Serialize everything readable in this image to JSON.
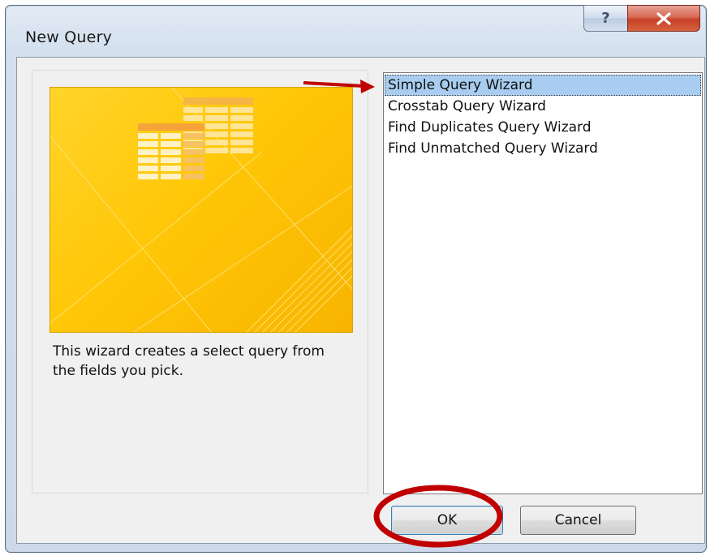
{
  "window": {
    "title": "New Query",
    "help_glyph": "?",
    "close_icon": "close-x-icon"
  },
  "left_panel": {
    "image": "query-wizard-illustration",
    "description": "This wizard creates a select query from the fields you pick."
  },
  "wizard_list": {
    "items": [
      {
        "label": "Simple Query Wizard",
        "selected": true
      },
      {
        "label": "Crosstab Query Wizard",
        "selected": false
      },
      {
        "label": "Find Duplicates Query Wizard",
        "selected": false
      },
      {
        "label": "Find Unmatched Query Wizard",
        "selected": false
      }
    ]
  },
  "buttons": {
    "ok_label": "OK",
    "cancel_label": "Cancel"
  },
  "colors": {
    "selection": "#a8cdf0",
    "image_gold": "#ffc708",
    "annotation_red": "#c00000",
    "close_red": "#c73f27"
  }
}
